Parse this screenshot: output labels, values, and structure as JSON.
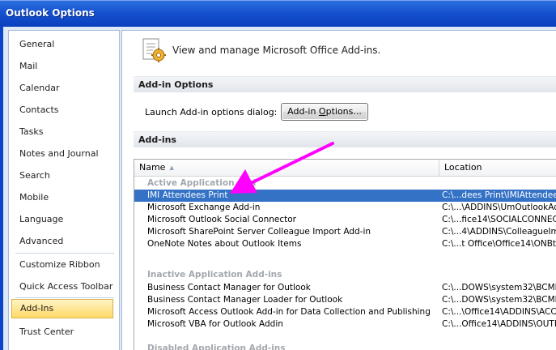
{
  "window": {
    "title": "Outlook Options"
  },
  "nav": {
    "items": [
      {
        "label": "General"
      },
      {
        "label": "Mail"
      },
      {
        "label": "Calendar"
      },
      {
        "label": "Contacts"
      },
      {
        "label": "Tasks"
      },
      {
        "label": "Notes and Journal"
      },
      {
        "label": "Search"
      },
      {
        "label": "Mobile"
      },
      {
        "label": "Language"
      },
      {
        "label": "Advanced"
      },
      {
        "label": "Customize Ribbon"
      },
      {
        "label": "Quick Access Toolbar"
      },
      {
        "label": "Add-Ins"
      },
      {
        "label": "Trust Center"
      }
    ],
    "selected": "Add-Ins"
  },
  "header": {
    "text": "View and manage Microsoft Office Add-ins.",
    "icon": "addins-gear-icon"
  },
  "addin_options": {
    "section_title": "Add-in Options",
    "launch_label": "Launch Add-in options dialog:",
    "button_label_before": "Add-in ",
    "button_label_accel": "O",
    "button_label_after": "ptions..."
  },
  "addins": {
    "section_title": "Add-ins",
    "columns": {
      "name": "Name",
      "location": "Location"
    },
    "groups": [
      {
        "title": "Active Application Add",
        "rows": [
          {
            "name": "IMI Attendees Print",
            "location": "C:\\...dees Print\\IMIAttendee",
            "selected": true
          },
          {
            "name": "Microsoft Exchange Add-in",
            "location": "C:\\...\\ADDINS\\UmOutlookAd"
          },
          {
            "name": "Microsoft Outlook Social Connector",
            "location": "C:\\...fice14\\SOCIALCONNECT"
          },
          {
            "name": "Microsoft SharePoint Server Colleague Import Add-in",
            "location": "C:\\...4\\ADDINS\\ColleagueIm"
          },
          {
            "name": "OneNote Notes about Outlook Items",
            "location": "C:\\...t Office\\Office14\\ONBt"
          }
        ]
      },
      {
        "title": "Inactive Application Add-ins",
        "rows": [
          {
            "name": "Business Contact Manager for Outlook",
            "location": "C:\\...DOWS\\system32\\BCMM"
          },
          {
            "name": "Business Contact Manager Loader for Outlook",
            "location": "C:\\...DOWS\\system32\\BCMM"
          },
          {
            "name": "Microsoft Access Outlook Add-in for Data Collection and Publishing",
            "location": "C:\\...\\Office14\\ADDINS\\ACC"
          },
          {
            "name": "Microsoft VBA for Outlook Addin",
            "location": "C:\\...Office14\\ADDINS\\OUTL"
          }
        ]
      },
      {
        "title": "Disabled Application Add-ins",
        "rows": []
      }
    ]
  },
  "annotation": {
    "color": "#ff00ff"
  },
  "colors": {
    "title_bar": "#1652d0",
    "selection": "#3472c6",
    "nav_selected": "#ffd966"
  }
}
